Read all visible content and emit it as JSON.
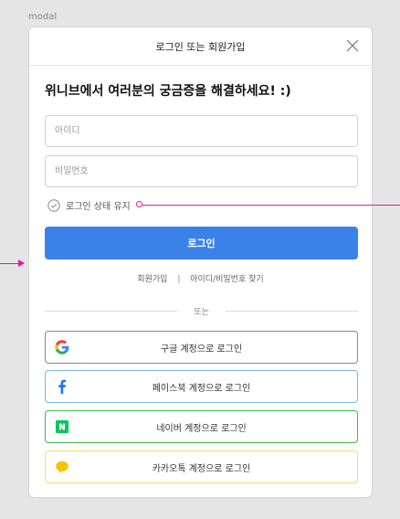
{
  "frame": {
    "label": "modal"
  },
  "modal": {
    "title": "로그인 또는 회원가입",
    "headline": "위니브에서 여러분의 궁금증을 해결하세요! :)",
    "id_placeholder": "아이디",
    "password_placeholder": "비밀번호",
    "remember_label": "로그인 상태 유지",
    "login_button": "로그인",
    "links": {
      "signup": "회원가입",
      "separator": "|",
      "find": "아이디/비밀번호 찾기"
    },
    "divider_label": "또는",
    "social": {
      "google": "구글 계정으로 로그인",
      "facebook": "페이스북 계정으로 로그인",
      "naver": "네이버 계정으로 로그인",
      "kakao": "카카오톡 계정으로 로그인"
    }
  },
  "colors": {
    "primary": "#3b82e8",
    "annotation": "#e8199b",
    "google_border": "#8a8a8a",
    "facebook_border": "#7fb6e0",
    "naver_border": "#3dbb4a",
    "kakao_border": "#f2dc70"
  },
  "icons": {
    "close": "close-icon",
    "remember": "check-circle-icon",
    "google": "google-icon",
    "facebook": "facebook-icon",
    "naver": "naver-icon",
    "kakao": "kakao-icon"
  }
}
